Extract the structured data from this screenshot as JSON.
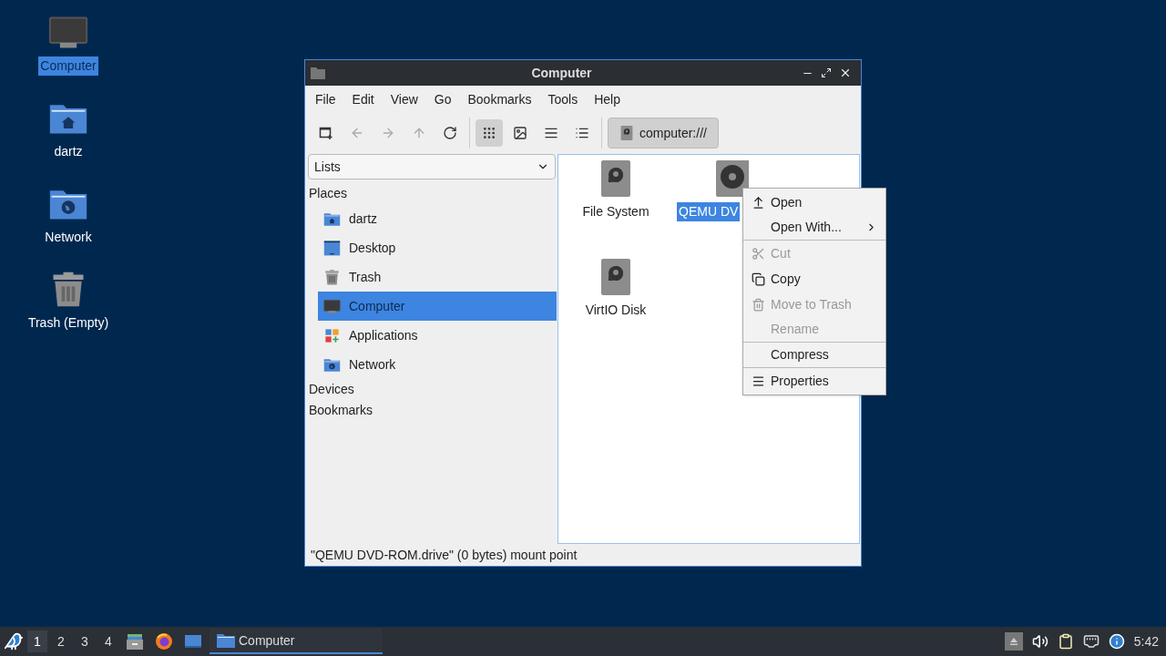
{
  "desktop_icons": [
    {
      "kind": "computer",
      "label": "Computer",
      "selected": true
    },
    {
      "kind": "home",
      "label": "dartz",
      "selected": false
    },
    {
      "kind": "network",
      "label": "Network",
      "selected": false
    },
    {
      "kind": "trash",
      "label": "Trash (Empty)",
      "selected": false
    }
  ],
  "window": {
    "title": "Computer",
    "menu": [
      "File",
      "Edit",
      "View",
      "Go",
      "Bookmarks",
      "Tools",
      "Help"
    ],
    "toolbar": [
      {
        "kind": "new-tab",
        "disabled": false,
        "selected": false
      },
      {
        "kind": "back",
        "disabled": true,
        "selected": false
      },
      {
        "kind": "forward",
        "disabled": true,
        "selected": false
      },
      {
        "kind": "up",
        "disabled": true,
        "selected": false
      },
      {
        "kind": "reload",
        "disabled": false,
        "selected": false
      },
      {
        "kind": "icons",
        "disabled": false,
        "selected": true
      },
      {
        "kind": "thumbnails",
        "disabled": false,
        "selected": false
      },
      {
        "kind": "compact",
        "disabled": false,
        "selected": false
      },
      {
        "kind": "details",
        "disabled": false,
        "selected": false
      }
    ],
    "path": "computer:///",
    "side_pane": {
      "mode": "Lists",
      "sections": [
        {
          "title": "Places",
          "items": [
            {
              "kind": "home",
              "label": "dartz",
              "selected": false
            },
            {
              "kind": "desktop",
              "label": "Desktop",
              "selected": false
            },
            {
              "kind": "trash",
              "label": "Trash",
              "selected": false
            },
            {
              "kind": "computer",
              "label": "Computer",
              "selected": true
            },
            {
              "kind": "apps",
              "label": "Applications",
              "selected": false
            },
            {
              "kind": "network",
              "label": "Network",
              "selected": false
            }
          ]
        },
        {
          "title": "Devices"
        },
        {
          "title": "Bookmarks"
        }
      ]
    },
    "files": [
      {
        "kind": "disk",
        "label": "File System",
        "selected": false
      },
      {
        "kind": "optical",
        "label": "QEMU DV",
        "selected": true
      },
      {
        "kind": "disk",
        "label": "VirtIO Disk",
        "selected": false
      }
    ],
    "status_bar": "\"QEMU DVD-ROM.drive\" (0 bytes) mount point"
  },
  "context_menu": [
    {
      "kind": "open",
      "label": "Open",
      "disabled": false,
      "submenu": false,
      "separator_after": false
    },
    {
      "kind": "none",
      "label": "Open With...",
      "disabled": false,
      "submenu": true,
      "separator_after": true
    },
    {
      "kind": "cut",
      "label": "Cut",
      "disabled": true,
      "submenu": false,
      "separator_after": false
    },
    {
      "kind": "copy",
      "label": "Copy",
      "disabled": false,
      "submenu": false,
      "separator_after": false
    },
    {
      "kind": "trash",
      "label": "Move to Trash",
      "disabled": true,
      "submenu": false,
      "separator_after": false
    },
    {
      "kind": "none",
      "label": "Rename",
      "disabled": true,
      "submenu": false,
      "separator_after": true
    },
    {
      "kind": "none",
      "label": "Compress",
      "disabled": false,
      "submenu": false,
      "separator_after": true
    },
    {
      "kind": "properties",
      "label": "Properties",
      "disabled": false,
      "submenu": false,
      "separator_after": false
    }
  ],
  "taskbar": {
    "workspaces": [
      {
        "label": "1",
        "selected": true
      },
      {
        "label": "2",
        "selected": false
      },
      {
        "label": "3",
        "selected": false
      },
      {
        "label": "4",
        "selected": false
      }
    ],
    "launchers": [
      {
        "kind": "files"
      },
      {
        "kind": "browser"
      },
      {
        "kind": "desktop"
      }
    ],
    "tasks": [
      {
        "label": "Computer",
        "selected": true
      }
    ],
    "tray": [
      {
        "kind": "eject"
      },
      {
        "kind": "volume"
      },
      {
        "kind": "clipboard"
      },
      {
        "kind": "network"
      },
      {
        "kind": "notification"
      }
    ],
    "clock": "5:42"
  }
}
